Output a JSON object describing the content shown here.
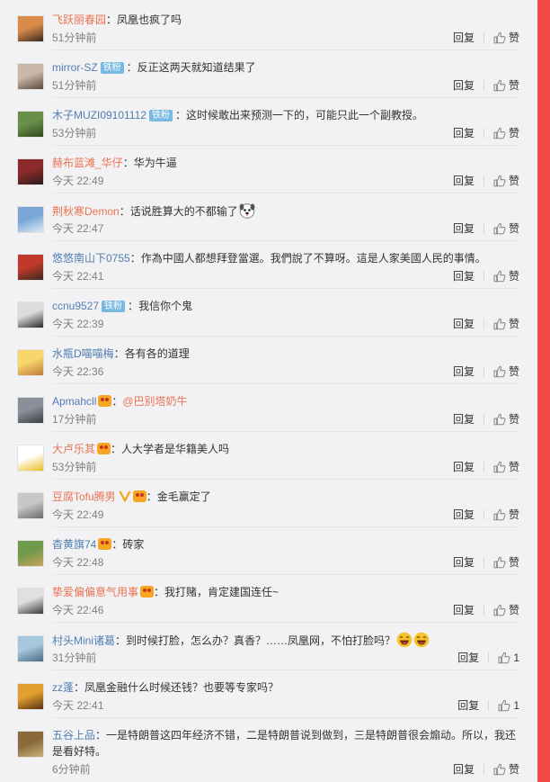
{
  "comments": [
    {
      "user": "飞跃丽春园",
      "badge": "",
      "text": "凤凰也疯了吗",
      "time": "51分钟前",
      "like": "赞",
      "colors": [
        "#d98c4a",
        "#3a2a1e"
      ]
    },
    {
      "user": "mirror-SZ",
      "badge": "铁粉",
      "text": "反正这两天就知道结果了",
      "time": "51分钟前",
      "like": "赞",
      "colors": [
        "#c9b7a8",
        "#5b4a3c"
      ]
    },
    {
      "user": "木子MUZI09101112",
      "badge": "铁粉",
      "text": "这时候敢出来预测一下的，可能只此一个副教授。",
      "time": "53分钟前",
      "like": "赞",
      "colors": [
        "#6a8f4a",
        "#2f4a20"
      ]
    },
    {
      "user": "赫布蓝滩_华仔",
      "badge": "",
      "text": "华为牛逼",
      "time": "今天 22:49",
      "like": "赞",
      "colors": [
        "#8b2b2b",
        "#2a1a1a"
      ]
    },
    {
      "user": "荆秋寒Demon",
      "badge": "",
      "text": "话说胜算大的不都输了",
      "time": "今天 22:47",
      "like": "赞",
      "colors": [
        "#7aa7d6",
        "#dfeaf5"
      ]
    },
    {
      "user": "悠悠南山下0755",
      "badge": "",
      "text": "作為中國人都想拜登當選。我們說了不算呀。這是人家美國人民的事情。",
      "time": "今天 22:41",
      "like": "赞",
      "colors": [
        "#c0392b",
        "#3b2b20"
      ]
    },
    {
      "user": "ccnu9527",
      "badge": "铁粉",
      "text": "我信你个鬼",
      "time": "今天 22:39",
      "like": "赞",
      "colors": [
        "#dddddd",
        "#2b2b2b"
      ]
    },
    {
      "user": "水瓶D喵喵梅",
      "badge": "",
      "text": "各有各的道理",
      "time": "今天 22:36",
      "like": "赞",
      "colors": [
        "#f7d76b",
        "#c07a3a"
      ]
    },
    {
      "user": "Apmahcll",
      "badge": "",
      "text": "",
      "mention": "@巴别塔奶牛",
      "time": "17分钟前",
      "like": "赞",
      "colors": [
        "#8a9099",
        "#3a3f45"
      ]
    },
    {
      "user": "大卢乐其",
      "badge": "",
      "text": "人大学者是华籍美人吗",
      "time": "53分钟前",
      "like": "赞",
      "colors": [
        "#ffffff",
        "#e8c020"
      ]
    },
    {
      "user": "豆腐Tofu腾男",
      "badge": "",
      "text": "金毛赢定了",
      "time": "今天 22:49",
      "like": "赞",
      "colors": [
        "#c8c8c8",
        "#6a6a6a"
      ]
    },
    {
      "user": "杳黄旗74",
      "badge": "",
      "text": "砖家",
      "time": "今天 22:48",
      "like": "赞",
      "colors": [
        "#6f9a4c",
        "#c9a35a"
      ]
    },
    {
      "user": "挚爱偏偏意气用事",
      "badge": "",
      "text": "我打赌，肯定建国连任~",
      "time": "今天 22:46",
      "like": "赞",
      "colors": [
        "#e0e0e0",
        "#3a3a3a"
      ]
    },
    {
      "user": "村头Mini诸葛",
      "badge": "",
      "text": "到时候打脸，怎么办？真香？……凤凰网，不怕打脸吗？",
      "time": "31分钟前",
      "like": "1",
      "colors": [
        "#a6c8de",
        "#4a6a80"
      ]
    },
    {
      "user": "zz蓬",
      "badge": "",
      "text": "凤凰金融什么时候还钱？也要等专家吗？",
      "time": "今天 22:41",
      "like": "1",
      "colors": [
        "#e0a030",
        "#5a3010"
      ]
    },
    {
      "user": "五谷上品",
      "badge": "",
      "text": "一是特朗普这四年经济不错，二是特朗普说到做到，三是特朗普很会煽动。所以，我还是看好特。",
      "time": "6分钟前",
      "like": "赞",
      "colors": [
        "#8a6a3a",
        "#c9b07a"
      ]
    }
  ],
  "reply_label": "回复",
  "colon": "：",
  "accent_colors": {
    "username": "#eb7350",
    "fan_badge": "#77b9e2",
    "right_bar": "#f24848"
  }
}
